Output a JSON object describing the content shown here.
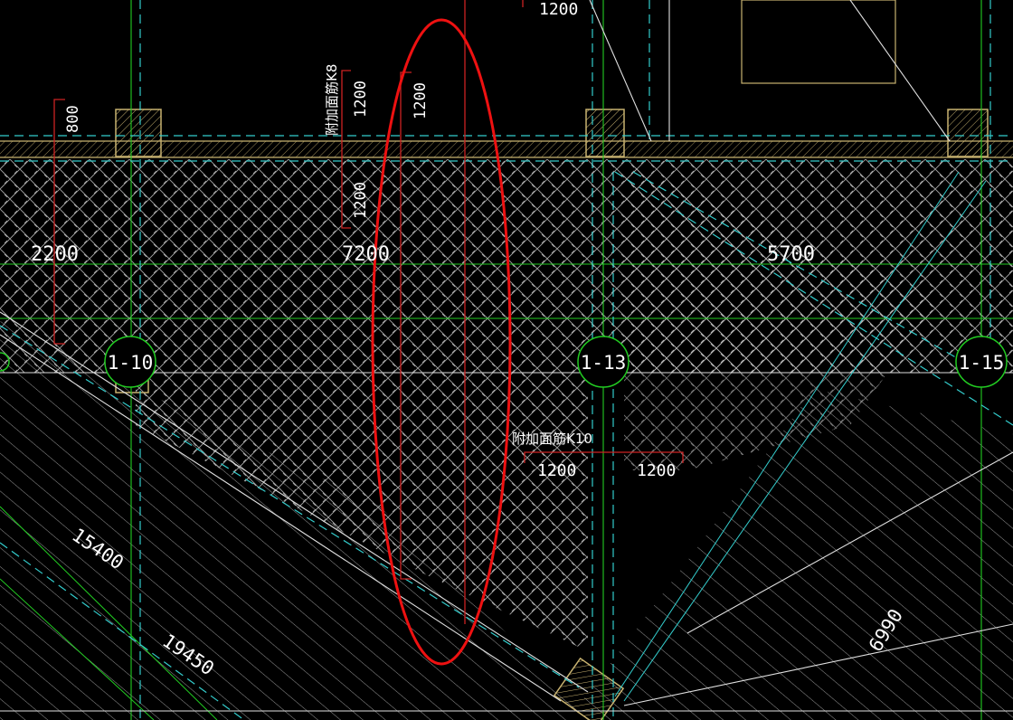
{
  "drawing": {
    "colors": {
      "background": "#000000",
      "axis_line": "#22cc22",
      "hidden_line": "#33cccc",
      "wall_outline": "#c8b270",
      "hatch": "#bcbcbc",
      "dimension_red": "#cc2222",
      "highlight_ellipse": "#ee1111",
      "text": "#ffffff"
    },
    "axis_bubbles": [
      {
        "label": "1-10"
      },
      {
        "label": "1-13"
      },
      {
        "label": "1-15"
      }
    ],
    "dimensions": {
      "top_1200": "1200",
      "left_800": "800",
      "span_2200": "2200",
      "span_7200": "7200",
      "span_5700": "5700",
      "rebar8_upper": "1200",
      "rebar8_lower": "1200",
      "mid_1200": "1200",
      "rebar10_left": "1200",
      "rebar10_right": "1200",
      "diag_15400": "15400",
      "diag_19450": "19450",
      "diag_6990": "6990"
    },
    "labels": {
      "rebar_label_8": "附加面筋K8",
      "rebar_label_10": "附加面筋K10"
    }
  }
}
